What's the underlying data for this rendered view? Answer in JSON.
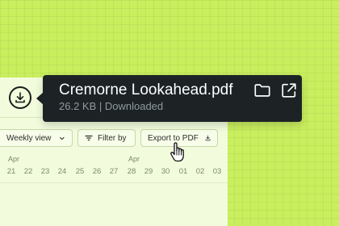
{
  "file": {
    "name": "Cremorne Lookahead.pdf",
    "size": "26.2 KB",
    "separator": "|",
    "status": "Downloaded",
    "meta": "26.2 KB | Downloaded"
  },
  "toolbar": {
    "view_label": "Weekly view",
    "filter_label": "Filter by",
    "export_label": "Export to PDF"
  },
  "calendar": {
    "months": [
      "Apr",
      "Apr"
    ],
    "days": [
      "21",
      "22",
      "23",
      "24",
      "25",
      "26",
      "27",
      "28",
      "29",
      "30",
      "01",
      "02",
      "03"
    ]
  },
  "icons": {
    "download": "download-icon",
    "folder": "folder-icon",
    "open_external": "external-link-icon",
    "chevron": "chevron-down-icon",
    "filter": "filter-icon",
    "export": "download-tray-icon",
    "cursor": "hand-pointer-icon"
  },
  "colors": {
    "background": "#c9ee5e",
    "panel": "#f2fbdc",
    "tooltip": "#1d2325",
    "tooltip_text": "#ffffff",
    "tooltip_meta": "#8e9a9e",
    "muted_text": "#7c8b63"
  }
}
